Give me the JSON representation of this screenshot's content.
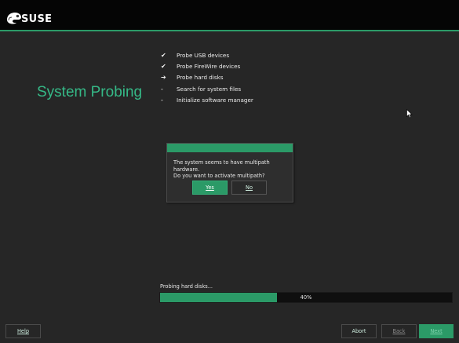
{
  "brand": {
    "logo_text": "SUSE"
  },
  "page": {
    "title": "System Probing"
  },
  "steps": [
    {
      "mark": "✔",
      "label": "Probe USB devices"
    },
    {
      "mark": "✔",
      "label": "Probe FireWire devices"
    },
    {
      "mark": "➔",
      "label": "Probe hard disks"
    },
    {
      "mark": "-",
      "label": "Search for system files"
    },
    {
      "mark": "-",
      "label": "Initialize software manager"
    }
  ],
  "dialog": {
    "message_line1": "The system seems to have multipath hardware.",
    "message_line2": "Do you want to activate multipath?",
    "yes_label": "Yes",
    "no_label": "No"
  },
  "progress": {
    "label": "Probing hard disks...",
    "percent_text": "40%",
    "value": 0.4
  },
  "footer": {
    "help_label": "Help",
    "abort_label": "Abort",
    "back_label": "Back",
    "next_label": "Next"
  },
  "colors": {
    "accent": "#2b9a67",
    "title": "#35b987",
    "background": "#262626",
    "topbar": "#050505"
  }
}
